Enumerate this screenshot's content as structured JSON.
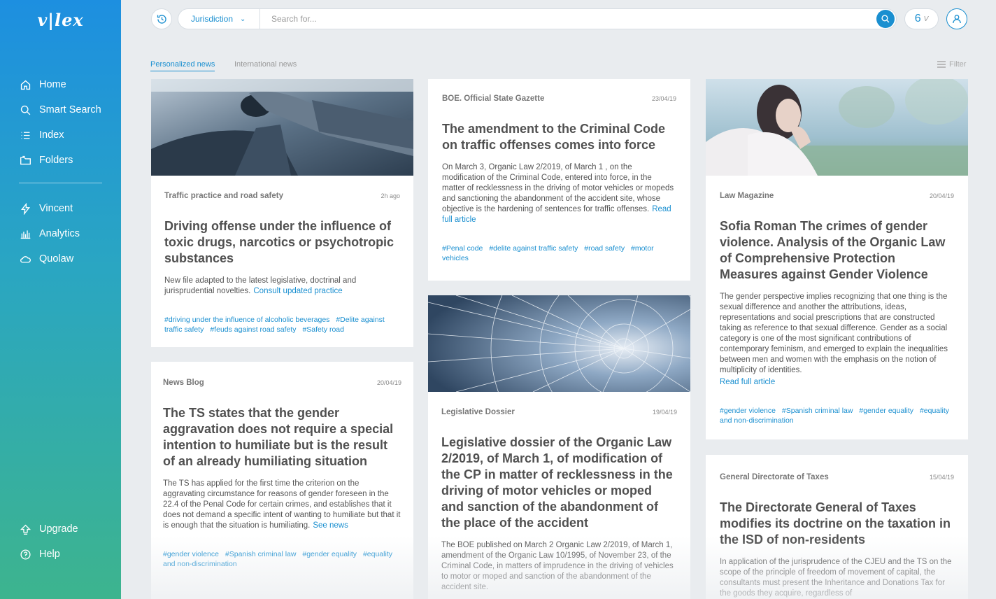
{
  "sidebar": {
    "logo": "v|lex",
    "items": [
      {
        "label": "Home"
      },
      {
        "label": "Smart Search"
      },
      {
        "label": "Index"
      },
      {
        "label": "Folders"
      },
      {
        "label": "Vincent"
      },
      {
        "label": "Analytics"
      },
      {
        "label": "Quolaw"
      }
    ],
    "bottom": [
      {
        "label": "Upgrade"
      },
      {
        "label": "Help"
      }
    ]
  },
  "topbar": {
    "jurisdiction_label": "Jurisdiction",
    "search_placeholder": "Search for...",
    "credits": "6",
    "credits_mark": "V"
  },
  "tabs": [
    {
      "label": "Personalized news",
      "active": true
    },
    {
      "label": "International news",
      "active": false
    }
  ],
  "filter_label": "Filter",
  "cards": [
    {
      "source": "Traffic practice and road safety",
      "date": "2h ago",
      "title": "Driving offense under the influence of toxic drugs, narcotics or psychotropic substances",
      "description": "New file adapted to the latest legislative, doctrinal and jurisprudential novelties.",
      "link": "Consult updated practice",
      "tags": [
        "#driving under the influence of alcoholic beverages",
        "#Delite against traffic safety",
        "#feuds against road safety",
        "#Safety road"
      ]
    },
    {
      "source": "News Blog",
      "date": "20/04/19",
      "title": "The TS states that the gender aggravation does not require a special intention to humiliate but is the result of an already humiliating situation",
      "description": "The TS has applied for the first time the criterion on the aggravating circumstance for reasons of gender foreseen in the 22.4 of the Penal Code for certain crimes, and establishes that it does not demand a specific intent of wanting to humiliate but that it is enough that the situation is humiliating.",
      "link": "See news",
      "tags": [
        "#gender violence",
        "#Spanish criminal law",
        "#gender equality",
        "#equality and non-discrimination"
      ]
    },
    {
      "source": "BOE. Official State Gazette",
      "date": "23/04/19",
      "title": "The amendment to the Criminal Code on traffic offenses comes into force",
      "description": "On March 3, Organic Law 2/2019, of March 1 , on the modification of the Criminal Code, entered into force, in the matter of recklessness in the driving of motor vehicles or mopeds and sanctioning the abandonment of the accident site, whose objective is the hardening of sentences for traffic offenses.",
      "link": "Read full article",
      "tags": [
        "#Penal code",
        "#delite against traffic safety",
        "#road safety",
        "#motor vehicles"
      ]
    },
    {
      "source": "Legislative Dossier",
      "date": "19/04/19",
      "title": "Legislative dossier of the Organic Law 2/2019, of March 1, of modification of the CP in matter of recklessness in the driving of motor vehicles or moped and sanction of the abandonment of the place of the accident",
      "description": "The BOE published on March 2 Organic Law 2/2019, of March 1, amendment of the Organic Law 10/1995, of November 23, of the Criminal Code, in matters of imprudence in the driving of vehicles to motor or moped and sanction of the abandonment of the accident site.",
      "link": "",
      "tags": []
    },
    {
      "source": "Law Magazine",
      "date": "20/04/19",
      "title": "Sofia Roman The crimes of gender violence. Analysis of the Organic Law of Comprehensive Protection Measures against Gender Violence",
      "description": "The gender perspective implies recognizing that one thing is the sexual difference and another the attributions, ideas, representations and social prescriptions that are constructed taking as reference to that sexual difference. Gender as a social category is one of the most significant contributions of contemporary feminism, and emerged to explain the inequalities between men and women with the emphasis on the notion of multiplicity of identities.",
      "link": "Read full article",
      "tags": [
        "#gender violence",
        "#Spanish criminal law",
        "#gender equality",
        "#equality and non-discrimination"
      ]
    },
    {
      "source": "General Directorate of Taxes",
      "date": "15/04/19",
      "title": "The Directorate General of Taxes modifies its doctrine on the taxation in the ISD of non-residents",
      "description": "In application of the jurisprudence of the CJEU and the TS on the scope of the principle of freedom of movement of capital, the consultants must present the Inheritance and Donations Tax for the goods they acquire, regardless of",
      "link": "",
      "tags": []
    }
  ]
}
